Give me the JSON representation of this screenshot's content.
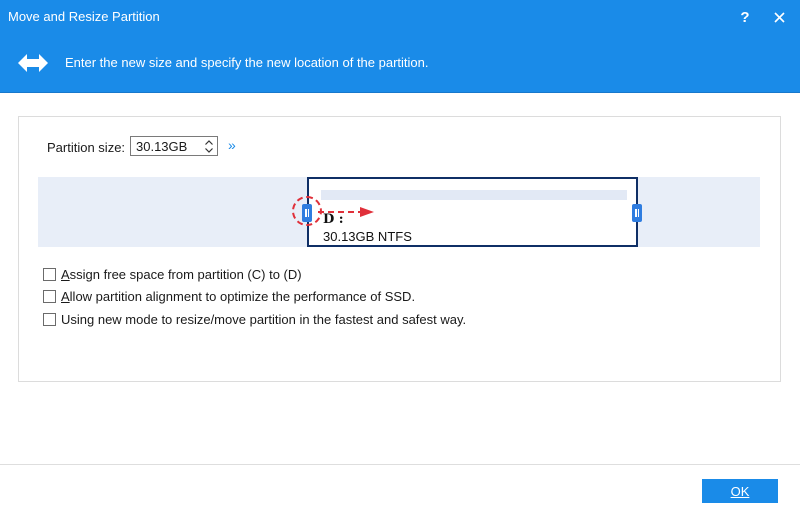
{
  "window": {
    "title": "Move and Resize Partition",
    "help_label": "?",
    "close_icon": "close-icon"
  },
  "banner": {
    "icon": "resize-arrows-icon",
    "text": "Enter the new size and specify the new location of the partition."
  },
  "partition_size": {
    "label": "Partition size:",
    "value": "30.13GB",
    "expand_label": "»"
  },
  "partition": {
    "letter": "D :",
    "info": "30.13GB NTFS"
  },
  "options": [
    {
      "label_underlined": "A",
      "label_rest": "ssign free space from partition (C) to (D)",
      "checked": false
    },
    {
      "label_underlined": "A",
      "label_rest": "llow partition alignment to optimize the performance of SSD.",
      "checked": false
    },
    {
      "label_underlined": "",
      "label_rest": "Using new mode to resize/move partition in the fastest and safest way.",
      "checked": false
    }
  ],
  "footer": {
    "ok_label": "OK"
  },
  "colors": {
    "accent": "#1a8be8",
    "partition_border": "#0f2f66",
    "handle": "#2f7de0",
    "drag_hint": "#e0303a"
  }
}
